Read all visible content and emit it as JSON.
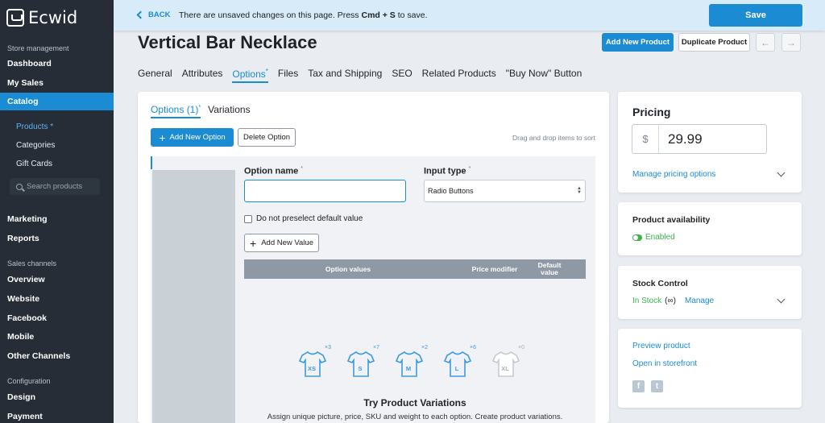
{
  "app": {
    "name": "Ecwid"
  },
  "sidebar": {
    "store_management": "Store management",
    "dashboard": "Dashboard",
    "my_sales": "My Sales",
    "catalog": "Catalog",
    "products": "Products",
    "products_marker": "*",
    "categories": "Categories",
    "gift_cards": "Gift Cards",
    "search_placeholder": "Search products",
    "marketing": "Marketing",
    "reports": "Reports",
    "sales_channels": "Sales channels",
    "overview": "Overview",
    "website": "Website",
    "facebook": "Facebook",
    "mobile": "Mobile",
    "other_channels": "Other Channels",
    "configuration": "Configuration",
    "design": "Design",
    "payment": "Payment"
  },
  "topbar": {
    "back": "BACK",
    "unsaved_prefix": "There are unsaved changes on this page. Press ",
    "shortcut": "Cmd + S",
    "unsaved_suffix": " to save.",
    "save": "Save"
  },
  "header": {
    "title": "Vertical Bar Necklace",
    "add_new_product": "Add New Product",
    "duplicate_product": "Duplicate Product",
    "prev": "←",
    "next": "→"
  },
  "tabs": {
    "general": "General",
    "attributes": "Attributes",
    "options": "Options",
    "options_marker": "*",
    "files": "Files",
    "tax_shipping": "Tax and Shipping",
    "seo": "SEO",
    "related": "Related Products",
    "buy_now": "\"Buy Now\" Button"
  },
  "options_panel": {
    "subtab_options": "Options (1)",
    "subtab_options_marker": "*",
    "subtab_variations": "Variations",
    "add_option": "Add New Option",
    "delete_option": "Delete Option",
    "drag_hint": "Drag and drop items to sort",
    "option_name_label": "Option name",
    "required_marker": "*",
    "input_type_label": "Input type",
    "input_type_value": "Radio Buttons",
    "preselect_label": "Do not preselect default value",
    "add_value": "Add New Value",
    "col_option_values": "Option values",
    "col_price_modifier": "Price modifier",
    "col_default_value": "Default value",
    "shirts": [
      {
        "size": "XS",
        "count": "×3"
      },
      {
        "size": "S",
        "count": "×7"
      },
      {
        "size": "M",
        "count": "×2"
      },
      {
        "size": "L",
        "count": "×6"
      },
      {
        "size": "XL",
        "count": "×0"
      }
    ],
    "try_title": "Try Product Variations",
    "try_desc": "Assign unique picture, price, SKU and weight to each option. Create product variations."
  },
  "pricing": {
    "title": "Pricing",
    "currency": "$",
    "price": "29.99",
    "manage_link": "Manage pricing options"
  },
  "availability": {
    "title": "Product availability",
    "status": "Enabled"
  },
  "stock": {
    "title": "Stock Control",
    "status": "In Stock",
    "infinity": "(∞)",
    "manage": "Manage"
  },
  "links": {
    "preview": "Preview product",
    "open_storefront": "Open in storefront",
    "facebook_letter": "f",
    "twitter_letter": "t"
  },
  "colors": {
    "accent": "#1b8bd4",
    "sidebar": "#262d36",
    "success": "#3bb34a"
  }
}
